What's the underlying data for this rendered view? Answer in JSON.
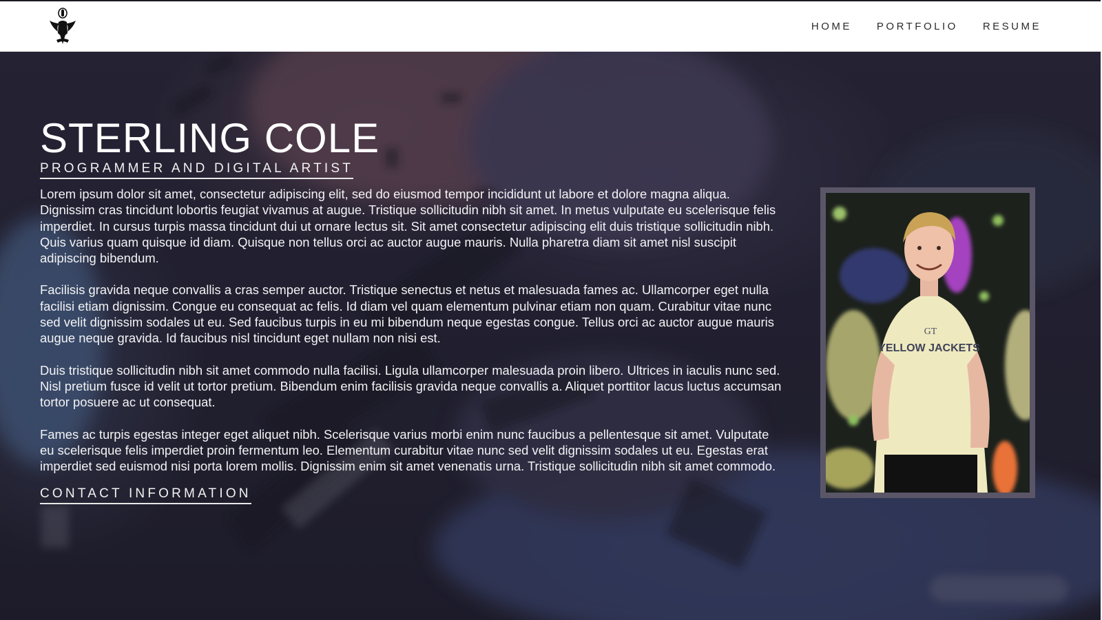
{
  "nav": {
    "logo_icon": "eagle-crest-icon",
    "links": [
      {
        "label": "HOME"
      },
      {
        "label": "PORTFOLIO"
      },
      {
        "label": "RESUME"
      }
    ]
  },
  "hero": {
    "name": "STERLING COLE",
    "subtitle": "PROGRAMMER AND DIGITAL ARTIST",
    "paragraphs": [
      "Lorem ipsum dolor sit amet, consectetur adipiscing elit, sed do eiusmod tempor incididunt ut labore et dolore magna aliqua. Dignissim cras tincidunt lobortis feugiat vivamus at augue. Tristique sollicitudin nibh sit amet. In metus vulputate eu scelerisque felis imperdiet. In cursus turpis massa tincidunt dui ut ornare lectus sit. Sit amet consectetur adipiscing elit duis tristique sollicitudin nibh. Quis varius quam quisque id diam. Quisque non tellus orci ac auctor augue mauris. Nulla pharetra diam sit amet nisl suscipit adipiscing bibendum.",
      "Facilisis gravida neque convallis a cras semper auctor. Tristique senectus et netus et malesuada fames ac. Ullamcorper eget nulla facilisi etiam dignissim. Congue eu consequat ac felis. Id diam vel quam elementum pulvinar etiam non quam. Curabitur vitae nunc sed velit dignissim sodales ut eu. Sed faucibus turpis in eu mi bibendum neque egestas congue. Tellus orci ac auctor augue mauris augue neque gravida. Id faucibus nisl tincidunt eget nullam non nisi est.",
      "Duis tristique sollicitudin nibh sit amet commodo nulla facilisi. Ligula ullamcorper malesuada proin libero. Ultrices in iaculis nunc sed. Nisl pretium fusce id velit ut tortor pretium. Bibendum enim facilisis gravida neque convallis a. Aliquet porttitor lacus luctus accumsan tortor posuere ac ut consequat.",
      "Fames ac turpis egestas integer eget aliquet nibh. Scelerisque varius morbi enim nunc faucibus a pellentesque sit amet. Vulputate eu scelerisque felis imperdiet proin fermentum leo. Elementum curabitur vitae nunc sed velit dignissim sodales ut eu. Egestas erat imperdiet sed euismod nisi porta lorem mollis. Dignissim enim sit amet venenatis urna. Tristique sollicitudin nibh sit amet commodo."
    ],
    "contact_label": "CONTACT INFORMATION",
    "portrait": {
      "shirt_text_top": "GT",
      "shirt_text": "YELLOW JACKETS"
    }
  },
  "colors": {
    "header_bg": "#ffffff",
    "hero_bg": "#23222f",
    "text": "#f1f1f4",
    "frame": "#5a5668"
  }
}
